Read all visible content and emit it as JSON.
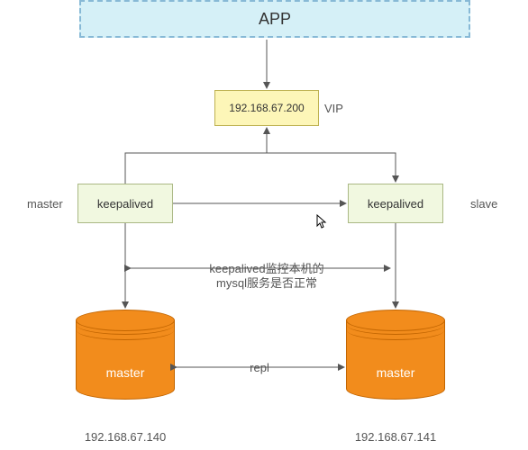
{
  "diagram": {
    "app": {
      "label": "APP"
    },
    "vip": {
      "ip": "192.168.67.200",
      "label": "VIP"
    },
    "nodes": {
      "left": {
        "role": "master",
        "keepalived_label": "keepalived",
        "db_label": "master",
        "ip": "192.168.67.140"
      },
      "right": {
        "role": "slave",
        "keepalived_label": "keepalived",
        "db_label": "master",
        "ip": "192.168.67.141"
      }
    },
    "annotations": {
      "monitor_line1": "keepalived监控本机的",
      "monitor_line2": "mysql服务是否正常",
      "replication": "repl"
    },
    "colors": {
      "app_bg": "#d5f0f7",
      "app_border": "#87b9d6",
      "vip_bg": "#fdf6b8",
      "vip_border": "#bdb151",
      "keepalived_bg": "#f1f8e0",
      "keepalived_border": "#aab884",
      "db_fill": "#f28c1c",
      "db_border": "#c26500",
      "arrow": "#555555"
    }
  }
}
